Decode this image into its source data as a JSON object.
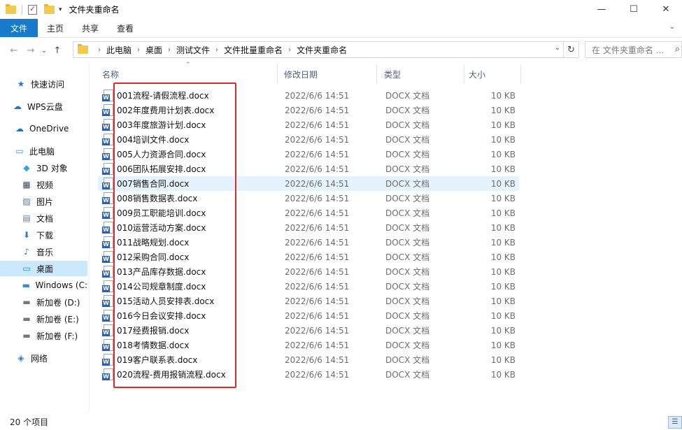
{
  "window": {
    "title": "文件夹重命名",
    "minimize": "—",
    "maximize": "☐",
    "close": "✕"
  },
  "ribbon": {
    "tabs": [
      "文件",
      "主页",
      "共享",
      "查看"
    ],
    "expand": "⌄"
  },
  "nav": {
    "back": "←",
    "forward": "→",
    "recent": "⌄",
    "up": "↑"
  },
  "address": {
    "crumbs": [
      "此电脑",
      "桌面",
      "测试文件",
      "文件批量重命名",
      "文件夹重命名"
    ],
    "search_placeholder": "在 文件夹重命名 ..."
  },
  "sidebar": {
    "items": [
      {
        "label": "快速访问",
        "icon": "star-icon",
        "glyph": "★",
        "color": "#2e78c7"
      },
      {
        "label": "WPS云盘",
        "icon": "cloud-icon",
        "glyph": "☁",
        "color": "#2a6fd6"
      },
      {
        "label": "OneDrive",
        "icon": "onedrive-icon",
        "glyph": "☁",
        "color": "#1a73d0"
      },
      {
        "label": "此电脑",
        "icon": "computer-icon",
        "glyph": "▭",
        "color": "#3a8ad6"
      },
      {
        "label": "3D 对象",
        "icon": "cube-icon",
        "glyph": "◆",
        "color": "#37a4d8"
      },
      {
        "label": "视频",
        "icon": "video-icon",
        "glyph": "▦",
        "color": "#404a5a"
      },
      {
        "label": "图片",
        "icon": "picture-icon",
        "glyph": "▨",
        "color": "#5a7a9a"
      },
      {
        "label": "文档",
        "icon": "document-icon",
        "glyph": "▤",
        "color": "#6a7c90"
      },
      {
        "label": "下载",
        "icon": "download-icon",
        "glyph": "⬇",
        "color": "#2e78c7"
      },
      {
        "label": "音乐",
        "icon": "music-icon",
        "glyph": "♪",
        "color": "#2e78c7"
      },
      {
        "label": "桌面",
        "icon": "desktop-icon",
        "glyph": "▭",
        "color": "#1a8ce0"
      },
      {
        "label": "Windows (C:",
        "icon": "windows-drive-icon",
        "glyph": "▬",
        "color": "#3a8ad6"
      },
      {
        "label": "新加卷 (D:)",
        "icon": "drive-icon",
        "glyph": "▬",
        "color": "#777777"
      },
      {
        "label": "新加卷 (E:)",
        "icon": "drive-icon",
        "glyph": "▬",
        "color": "#777777"
      },
      {
        "label": "新加卷 (F:)",
        "icon": "drive-icon",
        "glyph": "▬",
        "color": "#777777"
      },
      {
        "label": "网络",
        "icon": "network-icon",
        "glyph": "◈",
        "color": "#3a78b8"
      }
    ]
  },
  "columns": {
    "name": "名称",
    "date": "修改日期",
    "type": "类型",
    "size": "大小"
  },
  "files": [
    {
      "name": "001流程-请假流程.docx",
      "date": "2022/6/6 14:51",
      "type": "DOCX 文档",
      "size": "10 KB"
    },
    {
      "name": "002年度费用计划表.docx",
      "date": "2022/6/6 14:51",
      "type": "DOCX 文档",
      "size": "10 KB"
    },
    {
      "name": "003年度旅游计划.docx",
      "date": "2022/6/6 14:51",
      "type": "DOCX 文档",
      "size": "10 KB"
    },
    {
      "name": "004培训文件.docx",
      "date": "2022/6/6 14:51",
      "type": "DOCX 文档",
      "size": "10 KB"
    },
    {
      "name": "005人力资源合同.docx",
      "date": "2022/6/6 14:51",
      "type": "DOCX 文档",
      "size": "10 KB"
    },
    {
      "name": "006团队拓展安排.docx",
      "date": "2022/6/6 14:51",
      "type": "DOCX 文档",
      "size": "10 KB"
    },
    {
      "name": "007销售合同.docx",
      "date": "2022/6/6 14:51",
      "type": "DOCX 文档",
      "size": "10 KB"
    },
    {
      "name": "008销售数据表.docx",
      "date": "2022/6/6 14:51",
      "type": "DOCX 文档",
      "size": "10 KB"
    },
    {
      "name": "009员工职能培训.docx",
      "date": "2022/6/6 14:51",
      "type": "DOCX 文档",
      "size": "10 KB"
    },
    {
      "name": "010运营活动方案.docx",
      "date": "2022/6/6 14:51",
      "type": "DOCX 文档",
      "size": "10 KB"
    },
    {
      "name": "011战略规划.docx",
      "date": "2022/6/6 14:51",
      "type": "DOCX 文档",
      "size": "10 KB"
    },
    {
      "name": "012采购合同.docx",
      "date": "2022/6/6 14:51",
      "type": "DOCX 文档",
      "size": "10 KB"
    },
    {
      "name": "013产品库存数据.docx",
      "date": "2022/6/6 14:51",
      "type": "DOCX 文档",
      "size": "10 KB"
    },
    {
      "name": "014公司规章制度.docx",
      "date": "2022/6/6 14:51",
      "type": "DOCX 文档",
      "size": "10 KB"
    },
    {
      "name": "015活动人员安排表.docx",
      "date": "2022/6/6 14:51",
      "type": "DOCX 文档",
      "size": "10 KB"
    },
    {
      "name": "016今日会议安排.docx",
      "date": "2022/6/6 14:51",
      "type": "DOCX 文档",
      "size": "10 KB"
    },
    {
      "name": "017经费报销.docx",
      "date": "2022/6/6 14:51",
      "type": "DOCX 文档",
      "size": "10 KB"
    },
    {
      "name": "018考情数据.docx",
      "date": "2022/6/6 14:51",
      "type": "DOCX 文档",
      "size": "10 KB"
    },
    {
      "name": "019客户联系表.docx",
      "date": "2022/6/6 14:51",
      "type": "DOCX 文档",
      "size": "10 KB"
    },
    {
      "name": "020流程-费用报销流程.docx",
      "date": "2022/6/6 14:51",
      "type": "DOCX 文档",
      "size": "10 KB"
    }
  ],
  "hover_row_index": 6,
  "selected_sidebar_index": 10,
  "status": {
    "count": "20 个项目"
  },
  "colors": {
    "file_tab": "#1979ca",
    "selection": "#cce8ff",
    "hover": "#e5f3ff",
    "highlight_box": "#e02a2a"
  }
}
